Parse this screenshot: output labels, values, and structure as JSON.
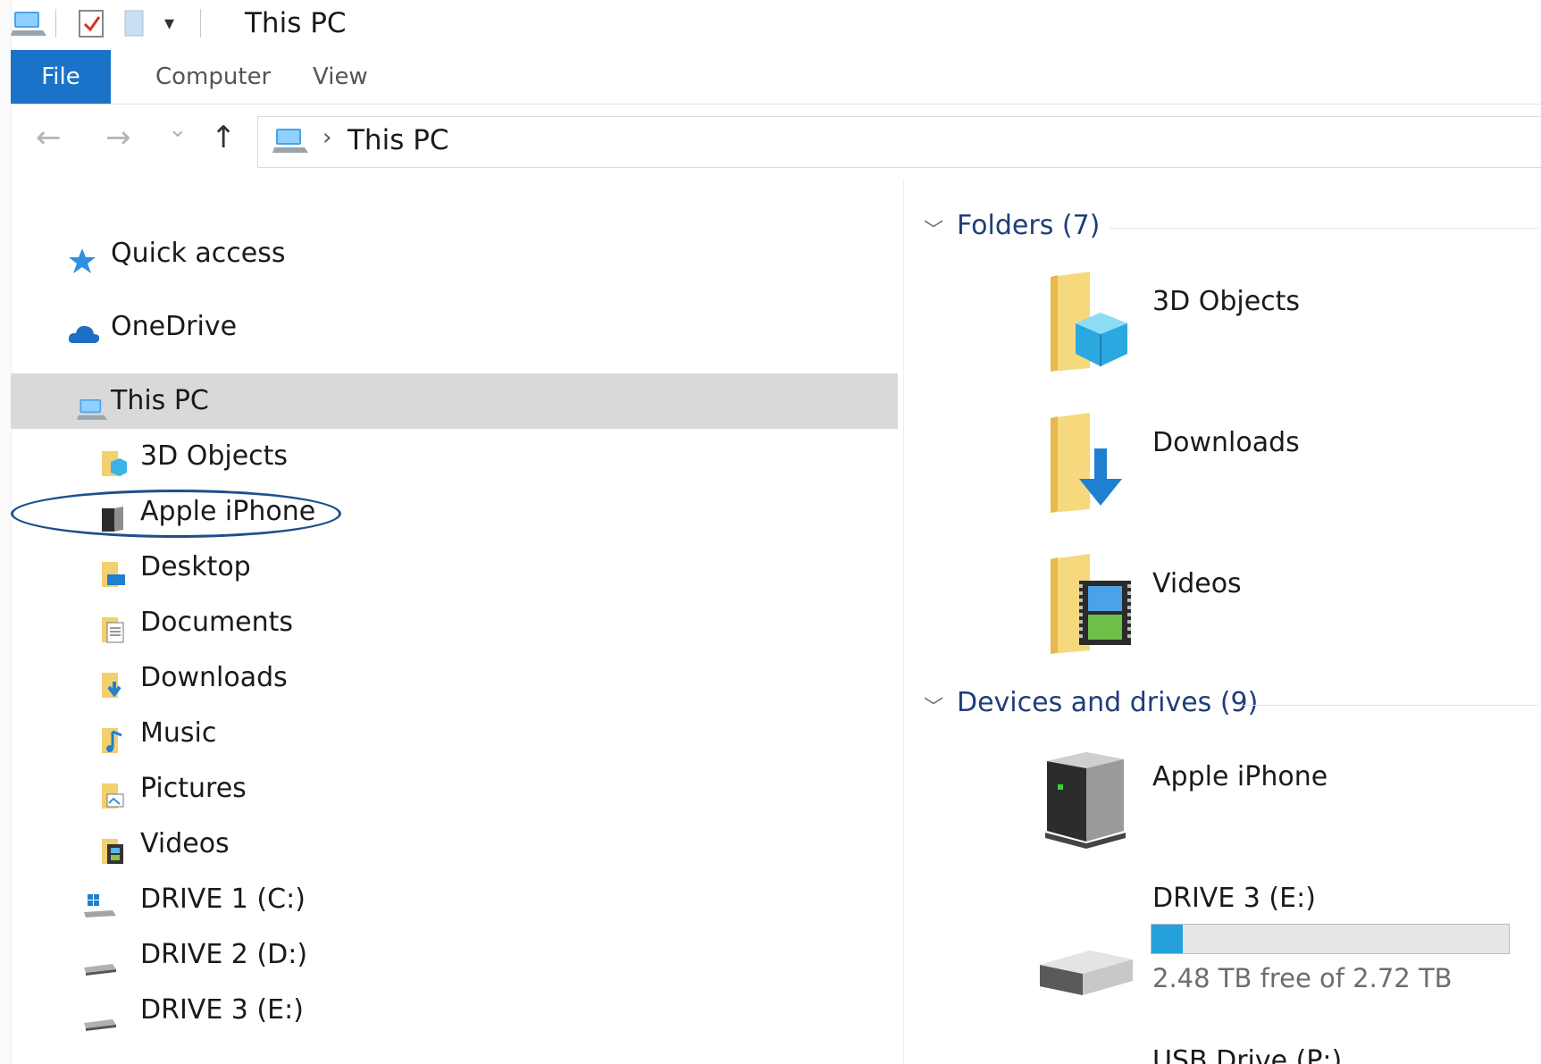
{
  "window": {
    "title": "This PC",
    "qat_dropdown_glyph": "▾"
  },
  "ribbon": {
    "tabs": [
      {
        "label": "File",
        "active": true
      },
      {
        "label": "Computer",
        "active": false
      },
      {
        "label": "View",
        "active": false
      }
    ]
  },
  "nav": {
    "back_glyph": "←",
    "forward_glyph": "→",
    "recent_glyph": "⌄",
    "up_glyph": "↑",
    "address_chevron": "›",
    "address_path": "This PC"
  },
  "sidebar": {
    "items": [
      {
        "label": "Quick access",
        "icon": "star-icon"
      },
      {
        "label": "OneDrive",
        "icon": "cloud-icon"
      },
      {
        "label": "This PC",
        "icon": "computer-icon",
        "selected": true
      },
      {
        "label": "3D Objects",
        "icon": "3d-objects-folder-icon"
      },
      {
        "label": "Apple iPhone",
        "icon": "phone-device-icon",
        "highlighted": true
      },
      {
        "label": "Desktop",
        "icon": "desktop-folder-icon"
      },
      {
        "label": "Documents",
        "icon": "documents-folder-icon"
      },
      {
        "label": "Downloads",
        "icon": "downloads-folder-icon"
      },
      {
        "label": "Music",
        "icon": "music-folder-icon"
      },
      {
        "label": "Pictures",
        "icon": "pictures-folder-icon"
      },
      {
        "label": "Videos",
        "icon": "videos-folder-icon"
      },
      {
        "label": "DRIVE 1 (C:)",
        "icon": "windows-drive-icon"
      },
      {
        "label": "DRIVE 2 (D:)",
        "icon": "drive-icon"
      },
      {
        "label": "DRIVE 3 (E:)",
        "icon": "drive-icon"
      }
    ]
  },
  "content": {
    "folders_header": "Folders (7)",
    "folders": [
      {
        "label": "3D Objects",
        "icon": "3d-objects-folder-icon"
      },
      {
        "label": "Downloads",
        "icon": "downloads-folder-icon"
      },
      {
        "label": "Videos",
        "icon": "videos-folder-icon"
      }
    ],
    "devices_header": "Devices and drives (9)",
    "devices": [
      {
        "label": "Apple iPhone",
        "icon": "portable-device-icon"
      },
      {
        "label": "DRIVE 3 (E:)",
        "icon": "hard-drive-icon",
        "used_fraction": 0.088,
        "free_text": "2.48 TB free of 2.72 TB"
      },
      {
        "label": "USB Drive (P:)",
        "icon": "usb-drive-icon"
      }
    ]
  },
  "colors": {
    "accent": "#1a73c8",
    "group_header": "#1e3d7a",
    "selection": "#d9d9d9",
    "drive_fill": "#26a0da",
    "annotation": "#1e4f8c"
  }
}
